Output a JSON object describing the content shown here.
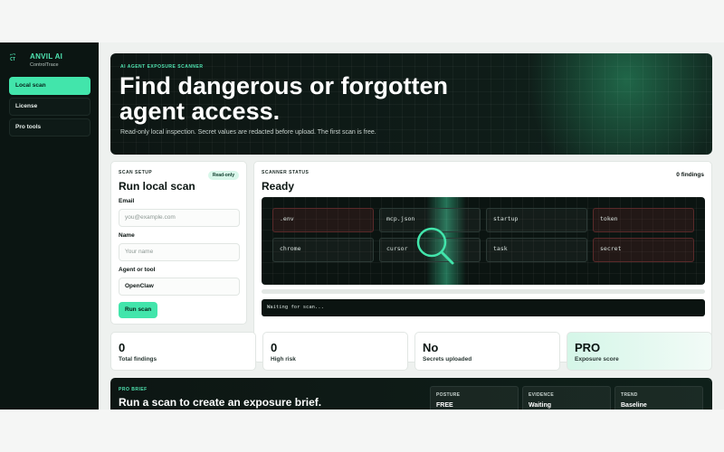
{
  "brand": {
    "logo": "CT",
    "name": "ANVIL AI",
    "subtitle": "ControlTrace"
  },
  "sidebar": {
    "items": [
      {
        "label": "Local scan",
        "active": true
      },
      {
        "label": "License",
        "active": false
      },
      {
        "label": "Pro tools",
        "active": false
      }
    ]
  },
  "hero": {
    "eyebrow": "AI AGENT EXPOSURE SCANNER",
    "title": "Find dangerous or forgotten agent access.",
    "subtitle": "Read-only local inspection. Secret values are redacted before upload. The first scan is free."
  },
  "setup": {
    "eyebrow": "SCAN SETUP",
    "badge": "Read-only",
    "title": "Run local scan",
    "email_label": "Email",
    "email_placeholder": "you@example.com",
    "name_label": "Name",
    "name_placeholder": "Your name",
    "agent_label": "Agent or tool",
    "agent_value": "OpenClaw",
    "run_label": "Run scan"
  },
  "status": {
    "eyebrow": "SCANNER STATUS",
    "findings": "0 findings",
    "title": "Ready",
    "chips": [
      ".env",
      "mcp.json",
      "startup",
      "token",
      "chrome",
      "cursor",
      "task",
      "secret"
    ],
    "progress": 0,
    "log": "Waiting for scan..."
  },
  "stats": [
    {
      "value": "0",
      "label": "Total findings"
    },
    {
      "value": "0",
      "label": "High risk"
    },
    {
      "value": "No",
      "label": "Secrets uploaded"
    },
    {
      "value": "PRO",
      "label": "Exposure score"
    }
  ],
  "brief": {
    "eyebrow": "PRO BRIEF",
    "title": "Run a scan to create an exposure brief.",
    "metrics": [
      {
        "label": "POSTURE",
        "value": "FREE"
      },
      {
        "label": "EVIDENCE",
        "value": "Waiting"
      },
      {
        "label": "TREND",
        "value": "Baseline"
      }
    ]
  },
  "colors": {
    "accent": "#42e5ab",
    "dark": "#0b1512",
    "danger_chip": "#5a2a2a"
  },
  "icons": {
    "scan": "magnifier-icon"
  }
}
